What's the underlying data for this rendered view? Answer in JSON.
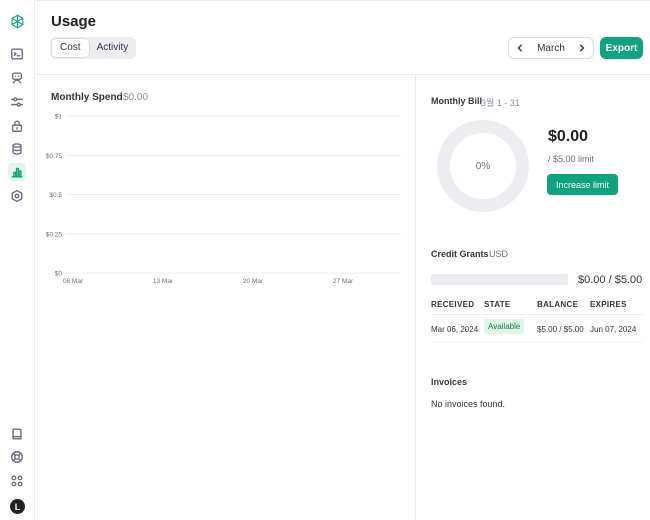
{
  "sidebar": {
    "logo": "openai-logo-icon",
    "items": [
      {
        "icon": "terminal-icon"
      },
      {
        "icon": "assistant-icon"
      },
      {
        "icon": "sliders-icon"
      },
      {
        "icon": "lock-icon"
      },
      {
        "icon": "database-icon"
      },
      {
        "icon": "usage-chart-icon",
        "active": true
      },
      {
        "icon": "settings-icon"
      }
    ],
    "bottom": [
      {
        "icon": "book-icon"
      },
      {
        "icon": "help-icon"
      },
      {
        "icon": "apps-icon"
      }
    ],
    "avatar_initial": "L"
  },
  "header": {
    "title": "Usage",
    "tabs": [
      {
        "label": "Cost",
        "active": true
      },
      {
        "label": "Activity",
        "active": false
      }
    ],
    "month": "March",
    "export_label": "Export"
  },
  "monthly_spend": {
    "title": "Monthly Spend",
    "amount": "$0.00"
  },
  "chart_data": {
    "type": "bar",
    "title": "Monthly Spend",
    "xlabel": "",
    "ylabel": "",
    "x_ticks": [
      "06 Mar",
      "13 Mar",
      "20 Mar",
      "27 Mar"
    ],
    "y_ticks": [
      "$0",
      "$0.25",
      "$0.5",
      "$0.75",
      "$1"
    ],
    "ylim": [
      0,
      1
    ],
    "grid": true,
    "series": [
      {
        "values": [
          0,
          0,
          0,
          0
        ]
      }
    ]
  },
  "monthly_bill": {
    "title": "Monthly Bill",
    "range": "3월 1 - 31",
    "percent": "0%",
    "amount": "$0.00",
    "limit": "/ $5.00 limit",
    "increase_label": "Increase limit"
  },
  "credit_grants": {
    "title": "Credit Grants",
    "currency": "USD",
    "amount": "$0.00 / $5.00",
    "used_fraction": 0,
    "columns": [
      "RECEIVED",
      "STATE",
      "BALANCE",
      "EXPIRES"
    ],
    "rows": [
      {
        "received": "Mar 06, 2024",
        "state": "Available",
        "balance": "$5.00 / $5.00",
        "expires": "Jun 07, 2024"
      }
    ]
  },
  "invoices": {
    "title": "Invoices",
    "empty": "No invoices found."
  },
  "colors": {
    "accent": "#10a37f",
    "badge_bg": "#dff5e8",
    "badge_text": "#157a4a"
  }
}
